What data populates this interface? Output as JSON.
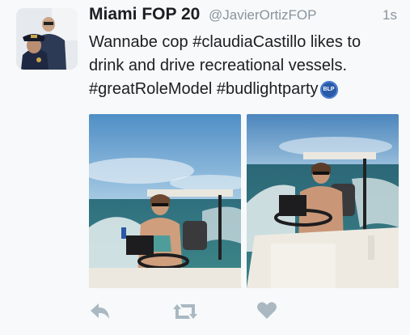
{
  "tweet": {
    "display_name": "Miami FOP 20",
    "handle": "@JavierOrtizFOP",
    "timestamp": "1s",
    "text_line1": "Wannabe cop #claudiaCastillo likes to",
    "text_line2": "drink and drive recreational vessels.",
    "text_line3": "#greatRoleModel #budlightparty",
    "emoji_badge": "BLP"
  },
  "media": {
    "photo1_description_icon": "photo-woman-driving-boat-icon",
    "photo2_description_icon": "photo-woman-driving-boat-icon"
  },
  "actions": {
    "reply_icon": "reply-icon",
    "retweet_icon": "retweet-icon",
    "like_icon": "heart-icon"
  },
  "colors": {
    "text": "#1c1e21",
    "muted": "#8a949e",
    "icon": "#aab8c2"
  }
}
